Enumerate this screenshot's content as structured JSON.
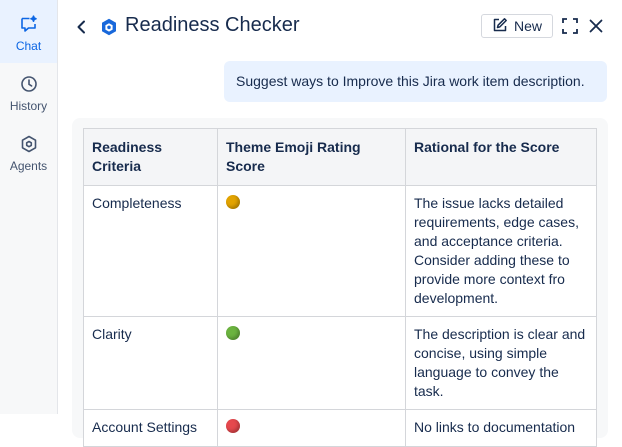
{
  "sidebar": {
    "items": [
      {
        "label": "Chat",
        "icon": "chat-sparkle-icon",
        "active": true
      },
      {
        "label": "History",
        "icon": "clock-icon",
        "active": false
      },
      {
        "label": "Agents",
        "icon": "agent-hexagon-icon",
        "active": false
      }
    ]
  },
  "header": {
    "title": "Readiness Checker",
    "new_label": "New"
  },
  "prompt": {
    "text": "Suggest ways to Improve this Jira work item description."
  },
  "table": {
    "headers": [
      "Readiness Criteria",
      "Theme Emoji Rating Score",
      "Rational for the Score"
    ],
    "rows": [
      {
        "criteria": "Completeness",
        "rating_color": "#e2a300",
        "rationale": "The issue lacks detailed requirements, edge cases, and acceptance criteria. Consider adding these to provide more context fro development."
      },
      {
        "criteria": "Clarity",
        "rating_color": "#6bb33f",
        "rationale": "The description is clear and concise, using simple language to convey the task."
      },
      {
        "criteria": "Account Settings",
        "rating_color": "#e5484d",
        "rationale": "No links to documentation"
      }
    ]
  },
  "colors": {
    "accent": "#0c66e4",
    "bubble": "#e9f2ff"
  }
}
